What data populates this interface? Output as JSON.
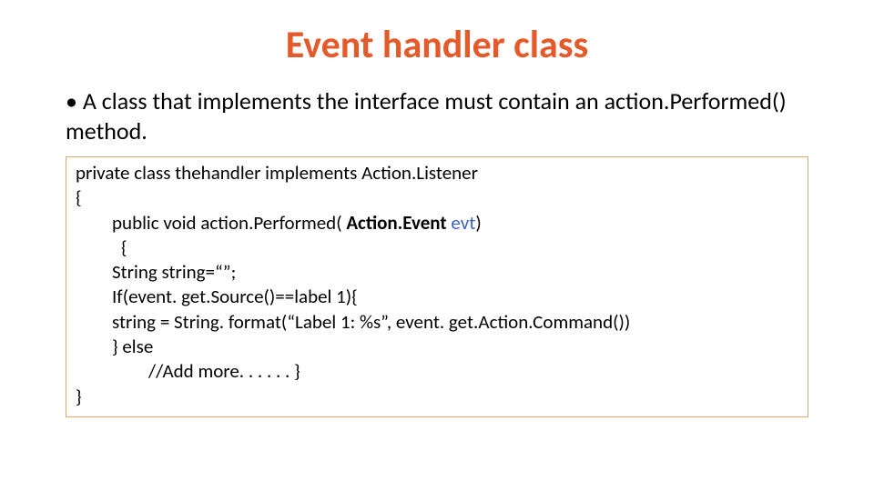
{
  "title": "Event handler class",
  "bullet": {
    "marker": "•",
    "text": "A class that implements the interface must contain an action.Performed() method."
  },
  "code": {
    "line1": "private class thehandler implements Action.Listener",
    "line2": "{",
    "line3_a": "public void action.Performed( ",
    "line3_b_class": "Action.Event",
    "line3_c_space": " ",
    "line3_d_var": "evt",
    "line3_e": ")",
    "line4": "{",
    "line5": "String string=“”;",
    "line6": "If(event. get.Source()==label 1){",
    "line7": "string = String. format(“Label 1: %s”, event. get.Action.Command())",
    "line8": "} else",
    "line9": "//Add more. . . . . . }",
    "line10": "}"
  }
}
